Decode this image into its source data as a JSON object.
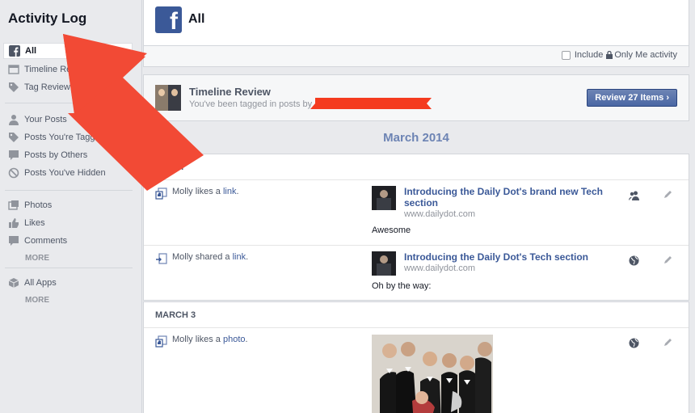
{
  "sidebar": {
    "title": "Activity Log",
    "items": [
      {
        "label": "All",
        "icon": "facebook-icon"
      },
      {
        "label": "Timeline Review",
        "icon": "timeline-icon"
      },
      {
        "label": "Tag Review",
        "icon": "tag-icon"
      },
      {
        "label": "Your Posts",
        "icon": "person-icon"
      },
      {
        "label": "Posts You're Tagged In",
        "icon": "tag-icon"
      },
      {
        "label": "Posts by Others",
        "icon": "speech-icon"
      },
      {
        "label": "Posts You've Hidden",
        "icon": "hidden-icon"
      },
      {
        "label": "Photos",
        "icon": "photos-icon"
      },
      {
        "label": "Likes",
        "icon": "like-icon"
      },
      {
        "label": "Comments",
        "icon": "comment-icon"
      },
      {
        "label": "All Apps",
        "icon": "apps-icon"
      }
    ],
    "more_label": "MORE"
  },
  "header": {
    "title": "All",
    "include_label": "Include",
    "only_me_label": "Only Me activity"
  },
  "review": {
    "title": "Timeline Review",
    "subtitle": "You've been tagged in posts by",
    "button_label": "Review 27 Items ›"
  },
  "month": "March 2014",
  "days": [
    {
      "label": "TODAY",
      "entries": [
        {
          "actor": "Molly",
          "action": "likes a",
          "object": "link",
          "link_title": "Introducing the Daily Dot's brand new Tech section",
          "link_url": "www.dailydot.com",
          "comment": "Awesome",
          "audience": "friends-icon"
        },
        {
          "actor": "Molly",
          "action": "shared a",
          "object": "link",
          "link_title": "Introducing the Daily Dot's Tech section",
          "link_url": "www.dailydot.com",
          "comment": "Oh by the way:",
          "audience": "globe-icon"
        }
      ]
    },
    {
      "label": "MARCH 3",
      "entries": [
        {
          "actor": "Molly",
          "action": "likes a",
          "object": "photo",
          "audience": "globe-icon"
        }
      ]
    }
  ],
  "colors": {
    "brand": "#3b5998",
    "button": "#4a67a4",
    "arrow": "#f24a35",
    "redaction": "#f43b1f"
  }
}
